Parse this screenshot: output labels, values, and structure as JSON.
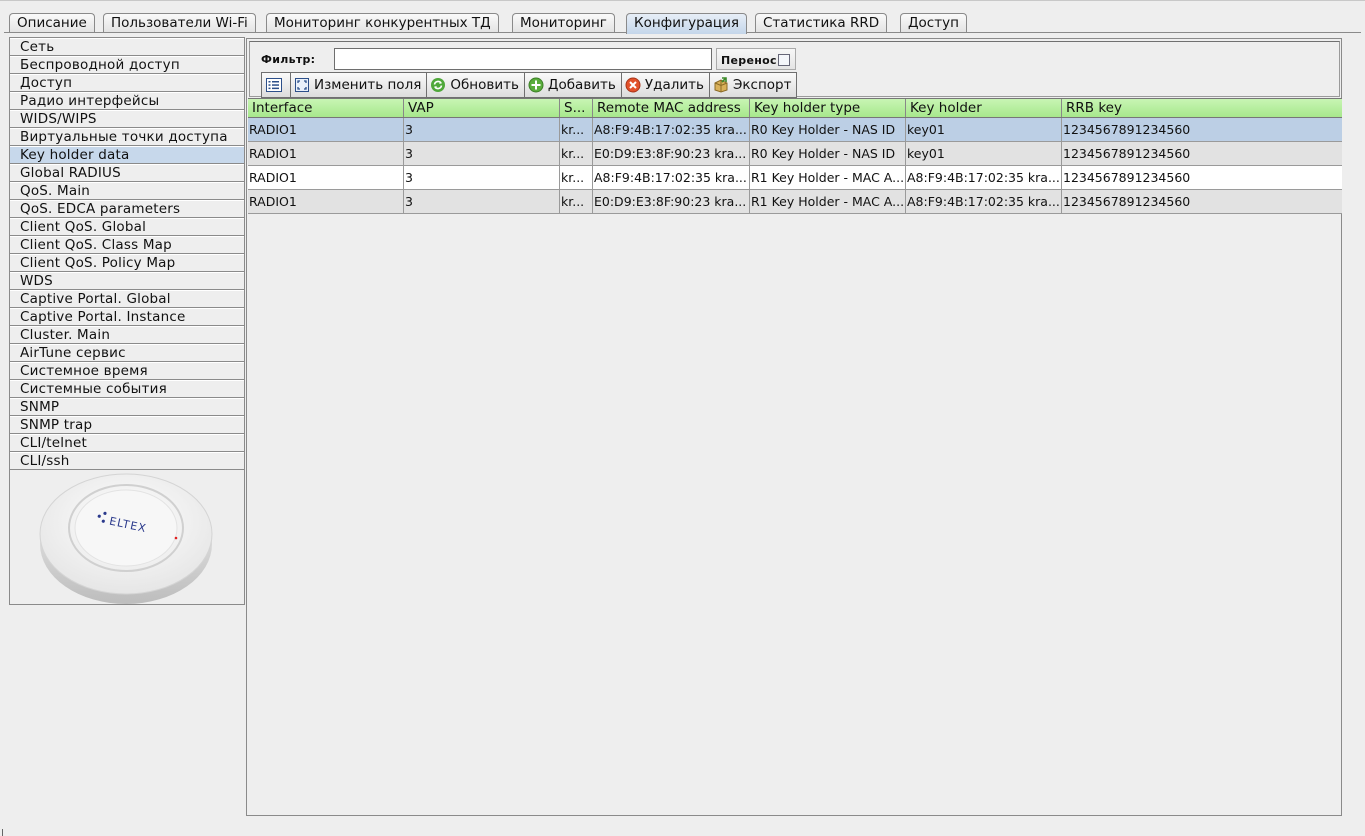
{
  "tabs": [
    "Описание",
    "Пользователи Wi-Fi",
    "Мониторинг конкурентных ТД",
    "Мониторинг",
    "Конфигурация",
    "Статистика RRD",
    "Доступ"
  ],
  "active_tab": "Конфигурация",
  "sidebar": {
    "items": [
      "Сеть",
      "Беспроводной доступ",
      "Доступ",
      "Радио интерфейсы",
      "WIDS/WIPS",
      "Виртуальные точки доступа",
      "Key holder data",
      "Global RADIUS",
      "QoS. Main",
      "QoS. EDCA parameters",
      "Client QoS. Global",
      "Client QoS. Class Map",
      "Client QoS. Policy Map",
      "WDS",
      "Captive Portal. Global",
      "Captive Portal. Instance",
      "Cluster. Main",
      "AirTune сервис",
      "Системное время",
      "Системные события",
      "SNMP",
      "SNMP trap",
      "CLI/telnet",
      "CLI/ssh"
    ],
    "selected": "Key holder data",
    "device_logo": "ELTEX"
  },
  "filter": {
    "label": "Фильтр:",
    "value": "",
    "wrap_label": "Перенос",
    "wrap_checked": false
  },
  "toolbar": {
    "columns_label": "Изменить поля",
    "refresh_label": "Обновить",
    "add_label": "Добавить",
    "delete_label": "Удалить",
    "export_label": "Экспорт"
  },
  "table": {
    "columns": [
      "Interface",
      "VAP",
      "S...",
      "Remote MAC address",
      "Key holder type",
      "Key holder",
      "RRB key"
    ],
    "rows": [
      [
        "RADIO1",
        "3",
        "kr...",
        "A8:F9:4B:17:02:35 kra...",
        "R0 Key Holder - NAS ID",
        "key01",
        "1234567891234560"
      ],
      [
        "RADIO1",
        "3",
        "kr...",
        "E0:D9:E3:8F:90:23 kra...",
        "R0 Key Holder - NAS ID",
        "key01",
        "1234567891234560"
      ],
      [
        "RADIO1",
        "3",
        "kr...",
        "A8:F9:4B:17:02:35 kra...",
        "R1 Key Holder - MAC A...",
        "A8:F9:4B:17:02:35 kra...",
        "1234567891234560"
      ],
      [
        "RADIO1",
        "3",
        "kr...",
        "E0:D9:E3:8F:90:23 kra...",
        "R1 Key Holder - MAC A...",
        "A8:F9:4B:17:02:35 kra...",
        "1234567891234560"
      ]
    ]
  },
  "colors": {
    "header_green": "#a7e88c",
    "selection_blue": "#bccfe5"
  }
}
